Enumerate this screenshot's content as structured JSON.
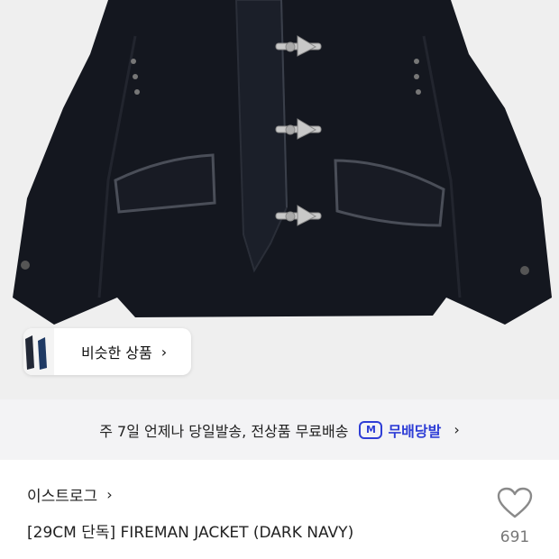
{
  "similar_products": {
    "label": "비슷한 상품",
    "chevron": "›"
  },
  "delivery": {
    "text": "주 7일 언제나 당일발송, 전상품 무료배송",
    "badge_icon_label": "M",
    "badge_label": "무배당발",
    "accent_color": "#2f3ed6",
    "chevron": "›"
  },
  "product": {
    "brand": "이스트로그",
    "brand_chevron": "›",
    "name": "[29CM 단독] FIREMAN JACKET (DARK NAVY)",
    "like_count": "691",
    "like_icon": "heart-outline-icon"
  }
}
